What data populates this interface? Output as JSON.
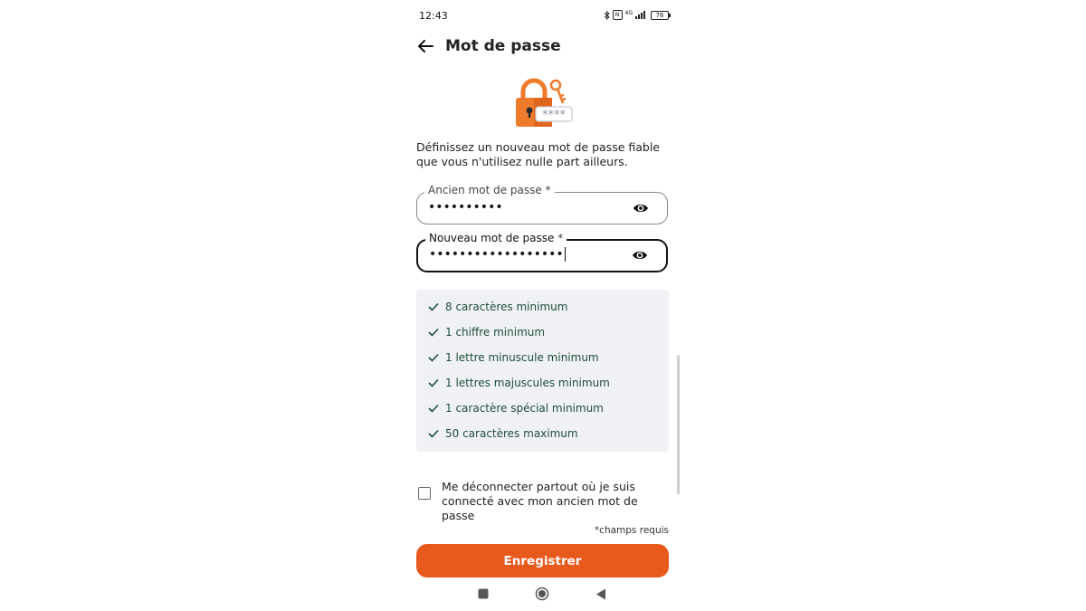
{
  "status_bar": {
    "time": "12:43",
    "battery": "76",
    "network": "4G"
  },
  "header": {
    "back_icon": "arrow-left-icon",
    "title": "Mot de passe"
  },
  "illustration": {
    "icon": "padlock-key-icon",
    "mask_text": "****"
  },
  "description": "Définissez un nouveau mot de passe fiable que vous n'utilisez nulle part ailleurs.",
  "fields": {
    "old_password": {
      "label": "Ancien mot de passe",
      "required_mark": "*",
      "value": "••••••••••",
      "toggle_icon": "eye-icon"
    },
    "new_password": {
      "label": "Nouveau mot de passe",
      "required_mark": "*",
      "value": "••••••••••••••••••",
      "toggle_icon": "eye-icon"
    }
  },
  "rules": [
    {
      "label": "8 caractères minimum",
      "icon": "check-icon"
    },
    {
      "label": "1 chiffre minimum",
      "icon": "check-icon"
    },
    {
      "label": "1 lettre minuscule minimum",
      "icon": "check-icon"
    },
    {
      "label": "1 lettres majuscules minimum",
      "icon": "check-icon"
    },
    {
      "label": "1 caractère spécial minimum",
      "icon": "check-icon"
    },
    {
      "label": "50 caractères maximum",
      "icon": "check-icon"
    }
  ],
  "logout_option": {
    "label": "Me déconnecter partout où je suis connecté avec mon ancien mot de passe",
    "checked": false
  },
  "required_note": "*champs requis",
  "save_button": "Enregistrer",
  "colors": {
    "accent": "#e85a1b",
    "rules_background": "#eff1f5",
    "rules_text": "#1f4d3a"
  }
}
